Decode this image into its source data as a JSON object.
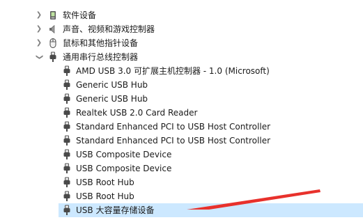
{
  "tree": {
    "categories": [
      {
        "label": "软件设备",
        "icon": "software-device-icon",
        "expanded": false
      },
      {
        "label": "声音、视频和游戏控制器",
        "icon": "speaker-icon",
        "expanded": false
      },
      {
        "label": "鼠标和其他指针设备",
        "icon": "mouse-icon",
        "expanded": false
      },
      {
        "label": "通用串行总线控制器",
        "icon": "usb-plug-icon",
        "expanded": true
      }
    ],
    "usb_children": [
      "AMD USB 3.0 可扩展主机控制器 - 1.0 (Microsoft)",
      "Generic USB Hub",
      "Generic USB Hub",
      "Realtek USB 2.0 Card Reader",
      "Standard Enhanced PCI to USB Host Controller",
      "Standard Enhanced PCI to USB Host Controller",
      "USB Composite Device",
      "USB Composite Device",
      "USB Root Hub",
      "USB Root Hub",
      "USB 大容量存储设备"
    ]
  },
  "colors": {
    "selection": "#cce8ff",
    "annotation_arrow": "#e8312c"
  }
}
